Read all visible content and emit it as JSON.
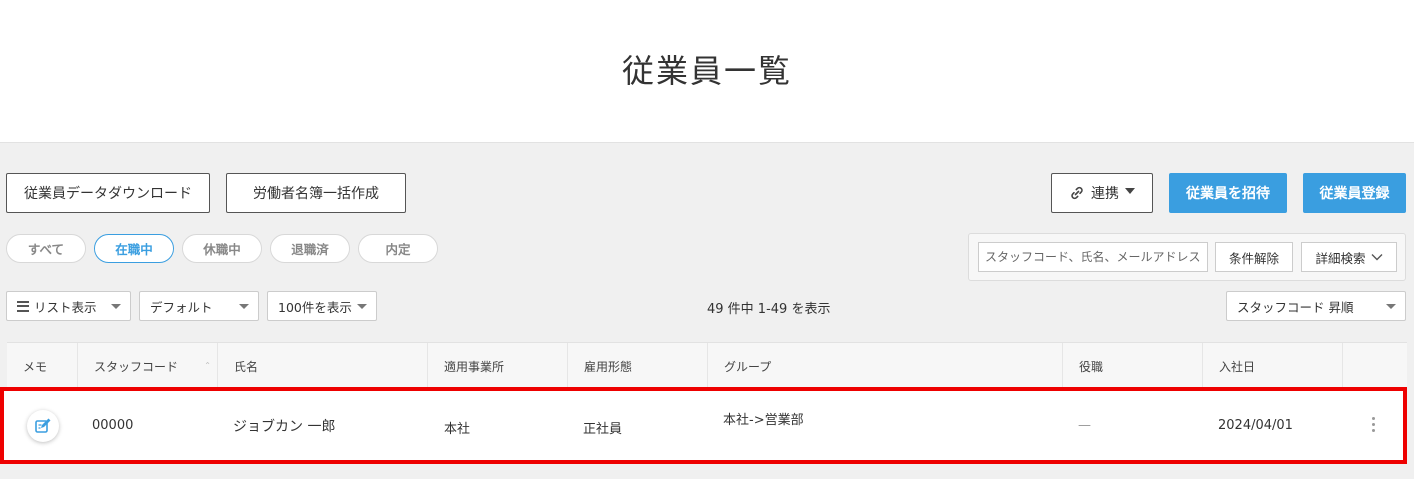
{
  "page": {
    "title": "従業員一覧"
  },
  "toolbar": {
    "download_label": "従業員データダウンロード",
    "roster_label": "労働者名簿一括作成",
    "link_label": "連携",
    "invite_label": "従業員を招待",
    "register_label": "従業員登録"
  },
  "status_tabs": [
    {
      "label": "すべて"
    },
    {
      "label": "在職中",
      "active": true
    },
    {
      "label": "休職中"
    },
    {
      "label": "退職済"
    },
    {
      "label": "内定"
    }
  ],
  "search": {
    "placeholder": "スタッフコード、氏名、メールアドレス",
    "clear_label": "条件解除",
    "advanced_label": "詳細検索"
  },
  "view_controls": {
    "view_mode": "リスト表示",
    "preset": "デフォルト",
    "per_page": "100件を表示",
    "count_text": "49 件中 1-49 を表示",
    "sort": "スタッフコード 昇順"
  },
  "table": {
    "columns": [
      "メモ",
      "スタッフコード",
      "氏名",
      "適用事業所",
      "雇用形態",
      "グループ",
      "役職",
      "入社日"
    ],
    "rows": [
      {
        "staff_code": "00000",
        "name": "ジョブカン 一郎",
        "office": "本社",
        "employment_type": "正社員",
        "group": "本社->営業部",
        "position": "—",
        "hire_date": "2024/04/01"
      }
    ]
  },
  "colors": {
    "accent": "#3a9ee0",
    "highlight": "#ee0000"
  },
  "icons": [
    "link-icon",
    "caret-down-icon",
    "chevron-down-icon",
    "list-view-icon",
    "memo-edit-icon",
    "sort-arrow-icon",
    "kebab-menu-icon"
  ]
}
